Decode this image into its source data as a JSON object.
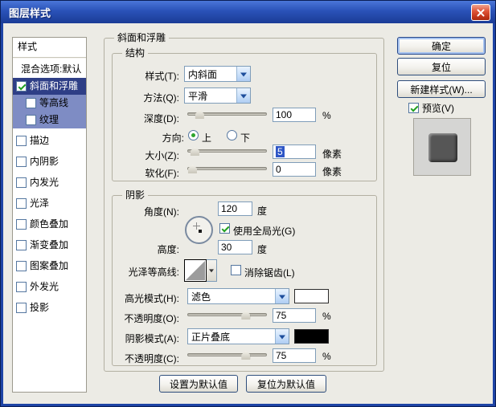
{
  "window": {
    "title": "图层样式"
  },
  "sidebar": {
    "header": "样式",
    "items": [
      {
        "id": "blending-options",
        "label": "混合选项:默认",
        "type": "plain"
      },
      {
        "id": "bevel-emboss",
        "label": "斜面和浮雕",
        "checked": true,
        "state": "sel"
      },
      {
        "id": "contour",
        "label": "等高线",
        "checked": false,
        "state": "hl"
      },
      {
        "id": "texture",
        "label": "纹理",
        "checked": false,
        "state": "hl"
      },
      {
        "id": "stroke",
        "label": "描边",
        "checked": false,
        "state": "gap"
      },
      {
        "id": "inner-shadow",
        "label": "内阴影",
        "checked": false,
        "state": "gap"
      },
      {
        "id": "inner-glow",
        "label": "内发光",
        "checked": false,
        "state": "gap"
      },
      {
        "id": "satin",
        "label": "光泽",
        "checked": false,
        "state": "gap"
      },
      {
        "id": "color-overlay",
        "label": "颜色叠加",
        "checked": false,
        "state": "gap"
      },
      {
        "id": "gradient-overlay",
        "label": "渐变叠加",
        "checked": false,
        "state": "gap"
      },
      {
        "id": "pattern-overlay",
        "label": "图案叠加",
        "checked": false,
        "state": "gap"
      },
      {
        "id": "outer-glow",
        "label": "外发光",
        "checked": false,
        "state": "gap"
      },
      {
        "id": "drop-shadow",
        "label": "投影",
        "checked": false,
        "state": "gap"
      }
    ]
  },
  "main": {
    "title": "斜面和浮雕",
    "structure": {
      "legend": "结构",
      "style_label": "样式(T):",
      "style_value": "内斜面",
      "technique_label": "方法(Q):",
      "technique_value": "平滑",
      "depth_label": "深度(D):",
      "depth_value": "100",
      "depth_unit": "%",
      "direction_label": "方向:",
      "direction_up": "上",
      "direction_down": "下",
      "size_label": "大小(Z):",
      "size_value": "5",
      "size_unit": "像素",
      "soften_label": "软化(F):",
      "soften_value": "0",
      "soften_unit": "像素"
    },
    "shading": {
      "legend": "阴影",
      "angle_label": "角度(N):",
      "angle_value": "120",
      "angle_unit": "度",
      "global_light_label": "使用全局光(G)",
      "altitude_label": "高度:",
      "altitude_value": "30",
      "altitude_unit": "度",
      "gloss_contour_label": "光泽等高线:",
      "antialias_label": "消除锯齿(L)",
      "highlight_mode_label": "高光模式(H):",
      "highlight_mode_value": "滤色",
      "highlight_opacity_label": "不透明度(O):",
      "highlight_opacity_value": "75",
      "highlight_opacity_unit": "%",
      "shadow_mode_label": "阴影模式(A):",
      "shadow_mode_value": "正片叠底",
      "shadow_opacity_label": "不透明度(C):",
      "shadow_opacity_value": "75",
      "shadow_opacity_unit": "%"
    },
    "footer": {
      "make_default": "设置为默认值",
      "reset_default": "复位为默认值"
    }
  },
  "actions": {
    "ok": "确定",
    "reset": "复位",
    "new_style": "新建样式(W)...",
    "preview": "预览(V)"
  },
  "colors": {
    "titlebar": "#2A52B8",
    "selected_row": "#2E3E86",
    "sub_row_highlight": "#7E8CC4",
    "highlight_mode_swatch": "#FFFFFF",
    "shadow_mode_swatch": "#000000",
    "check_green": "#21A121"
  }
}
